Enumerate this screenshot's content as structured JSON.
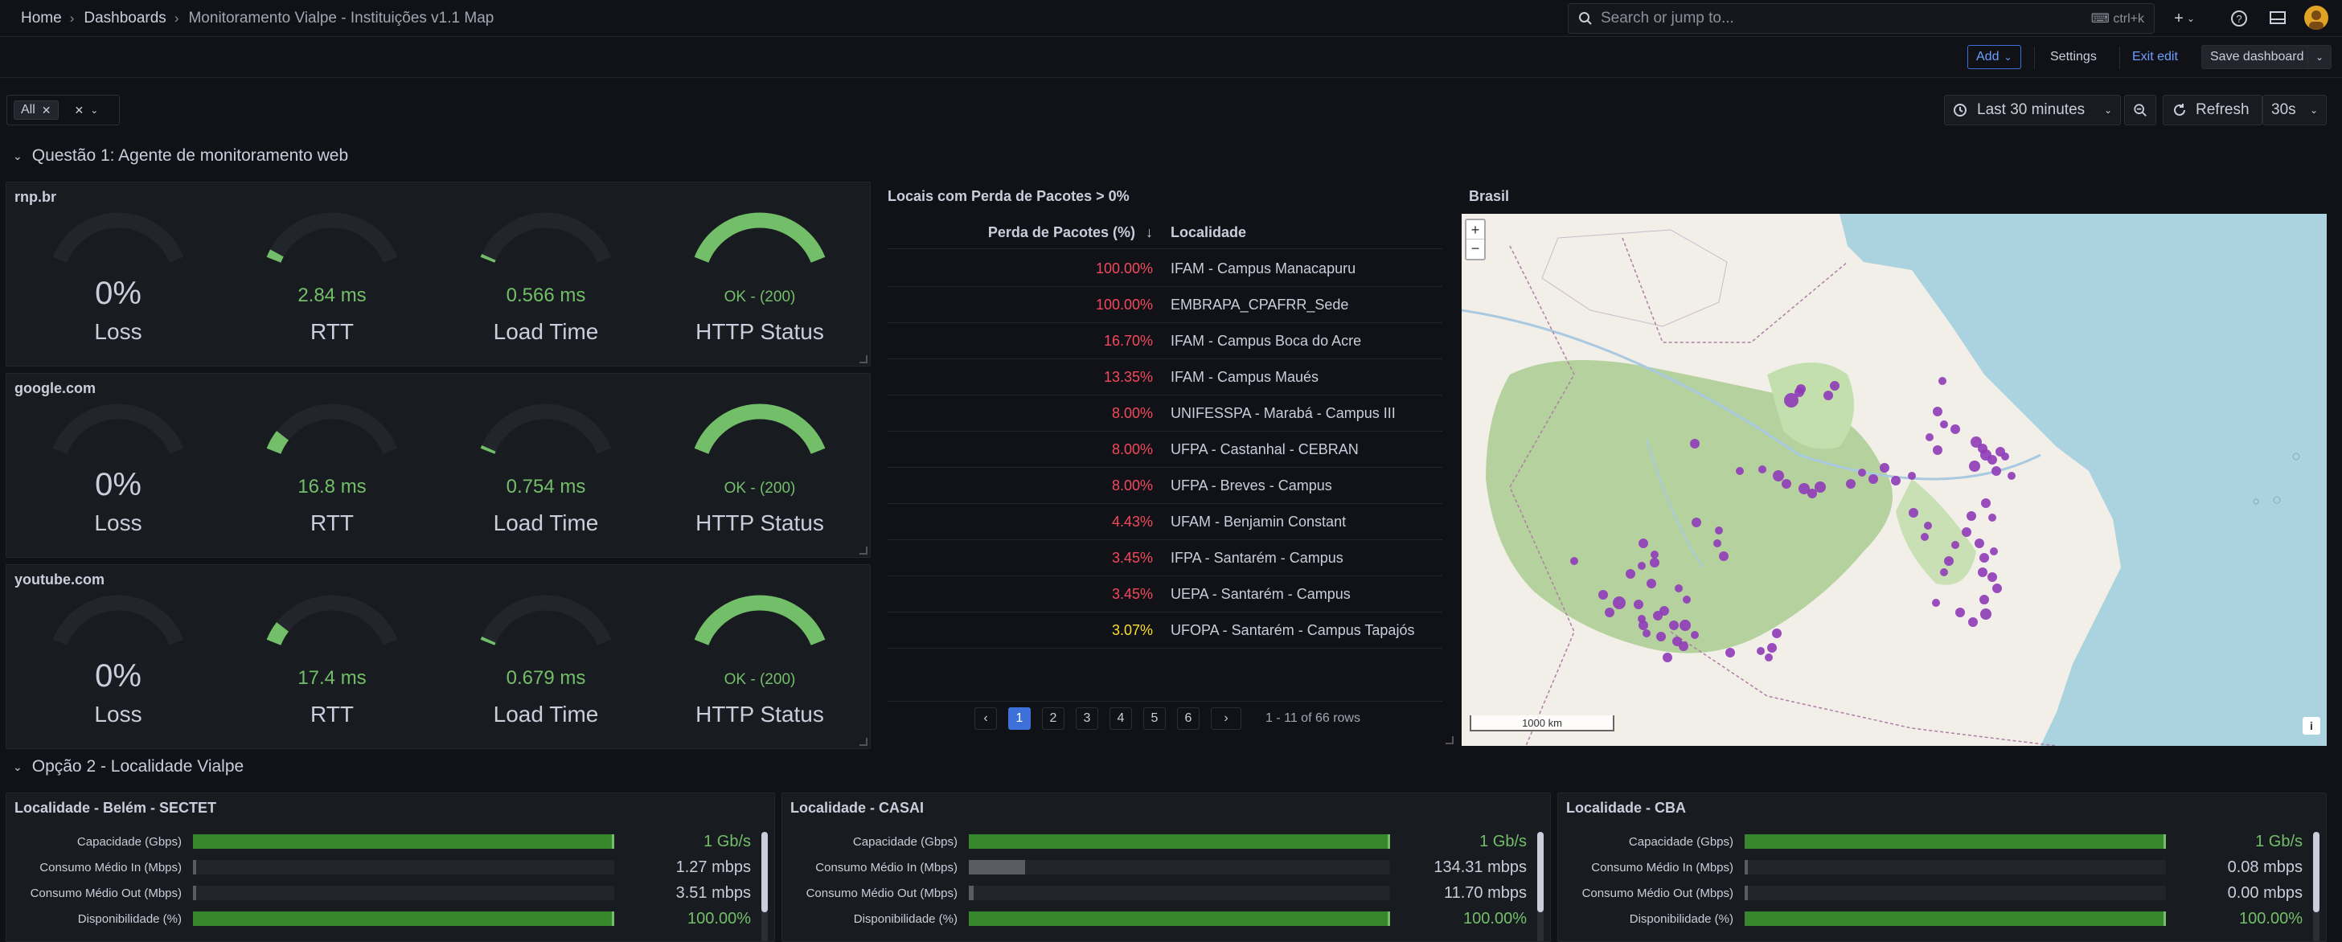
{
  "breadcrumb": {
    "home": "Home",
    "dashboards": "Dashboards",
    "current": "Monitoramento Vialpe - Instituições v1.1 Map"
  },
  "search": {
    "placeholder": "Search or jump to...",
    "shortcut": "ctrl+k"
  },
  "toolbar": {
    "add": "Add",
    "settings": "Settings",
    "exit_edit": "Exit edit",
    "save": "Save dashboard"
  },
  "filter": {
    "value": "All"
  },
  "time": {
    "range": "Last 30 minutes",
    "refresh": "Refresh",
    "interval": "30s"
  },
  "row1": {
    "title": "Questão 1: Agente de monitoramento web"
  },
  "gauges": [
    {
      "site": "rnp.br",
      "loss": "0%",
      "loss_label": "Loss",
      "rtt": "2.84 ms",
      "rtt_frac": 0.05,
      "rtt_label": "RTT",
      "load": "0.566 ms",
      "load_frac": 0.02,
      "load_label": "Load Time",
      "http": "OK - (200)",
      "http_label": "HTTP Status"
    },
    {
      "site": "google.com",
      "loss": "0%",
      "loss_label": "Loss",
      "rtt": "16.8 ms",
      "rtt_frac": 0.12,
      "rtt_label": "RTT",
      "load": "0.754 ms",
      "load_frac": 0.02,
      "load_label": "Load Time",
      "http": "OK - (200)",
      "http_label": "HTTP Status"
    },
    {
      "site": "youtube.com",
      "loss": "0%",
      "loss_label": "Loss",
      "rtt": "17.4 ms",
      "rtt_frac": 0.12,
      "rtt_label": "RTT",
      "load": "0.679 ms",
      "load_frac": 0.02,
      "load_label": "Load Time",
      "http": "OK - (200)",
      "http_label": "HTTP Status"
    }
  ],
  "table": {
    "title": "Locais com Perda de Pacotes > 0%",
    "col1": "Perda de Pacotes (%)",
    "col2": "Localidade",
    "rows": [
      {
        "pct": "100.00%",
        "loc": "IFAM - Campus Manacapuru",
        "color": "#f2495c"
      },
      {
        "pct": "100.00%",
        "loc": "EMBRAPA_CPAFRR_Sede",
        "color": "#f2495c"
      },
      {
        "pct": "16.70%",
        "loc": "IFAM - Campus Boca do Acre",
        "color": "#f2495c"
      },
      {
        "pct": "13.35%",
        "loc": "IFAM - Campus Maués",
        "color": "#f2495c"
      },
      {
        "pct": "8.00%",
        "loc": "UNIFESSPA - Marabá - Campus III",
        "color": "#f2495c"
      },
      {
        "pct": "8.00%",
        "loc": "UFPA - Castanhal - CEBRAN",
        "color": "#f2495c"
      },
      {
        "pct": "8.00%",
        "loc": "UFPA - Breves - Campus",
        "color": "#f2495c"
      },
      {
        "pct": "4.43%",
        "loc": "UFAM - Benjamin Constant",
        "color": "#f2495c"
      },
      {
        "pct": "3.45%",
        "loc": "IFPA - Santarém - Campus",
        "color": "#f2495c"
      },
      {
        "pct": "3.45%",
        "loc": "UEPA - Santarém - Campus",
        "color": "#f2495c"
      },
      {
        "pct": "3.07%",
        "loc": "UFOPA - Santarém - Campus Tapajós",
        "color": "#fade2a"
      }
    ],
    "pages": [
      "1",
      "2",
      "3",
      "4",
      "5",
      "6"
    ],
    "rows_info": "1 - 11 of 66 rows"
  },
  "map": {
    "title": "Brasil",
    "scale": "1000 km",
    "zoom_in": "+",
    "zoom_out": "−",
    "info": "i"
  },
  "row2": {
    "title": "Opção 2 - Localidade Vialpe"
  },
  "locs": [
    {
      "title": "Localidade - Belém - SECTET",
      "rows": [
        {
          "label": "Capacidade (Gbps)",
          "value": "1 Gb/s",
          "frac": 1,
          "color": "#73bf69",
          "kind": "green"
        },
        {
          "label": "Consumo Médio In (Mbps)",
          "value": "1.27 mbps",
          "frac": 0.003,
          "color": "#ccccdc",
          "kind": "gray"
        },
        {
          "label": "Consumo Médio Out (Mbps)",
          "value": "3.51 mbps",
          "frac": 0.004,
          "color": "#ccccdc",
          "kind": "gray"
        },
        {
          "label": "Disponibilidade (%)",
          "value": "100.00%",
          "frac": 1,
          "color": "#73bf69",
          "kind": "green"
        }
      ]
    },
    {
      "title": "Localidade - CASAI",
      "rows": [
        {
          "label": "Capacidade (Gbps)",
          "value": "1 Gb/s",
          "frac": 1,
          "color": "#73bf69",
          "kind": "green"
        },
        {
          "label": "Consumo Médio In (Mbps)",
          "value": "134.31 mbps",
          "frac": 0.134,
          "color": "#ccccdc",
          "kind": "gray"
        },
        {
          "label": "Consumo Médio Out (Mbps)",
          "value": "11.70 mbps",
          "frac": 0.012,
          "color": "#ccccdc",
          "kind": "gray"
        },
        {
          "label": "Disponibilidade (%)",
          "value": "100.00%",
          "frac": 1,
          "color": "#73bf69",
          "kind": "green"
        }
      ]
    },
    {
      "title": "Localidade - CBA",
      "rows": [
        {
          "label": "Capacidade (Gbps)",
          "value": "1 Gb/s",
          "frac": 1,
          "color": "#73bf69",
          "kind": "green"
        },
        {
          "label": "Consumo Médio In (Mbps)",
          "value": "0.08 mbps",
          "frac": 0.002,
          "color": "#ccccdc",
          "kind": "gray"
        },
        {
          "label": "Consumo Médio Out (Mbps)",
          "value": "0.00 mbps",
          "frac": 0.001,
          "color": "#ccccdc",
          "kind": "gray"
        },
        {
          "label": "Disponibilidade (%)",
          "value": "100.00%",
          "frac": 1,
          "color": "#73bf69",
          "kind": "green"
        }
      ]
    }
  ]
}
